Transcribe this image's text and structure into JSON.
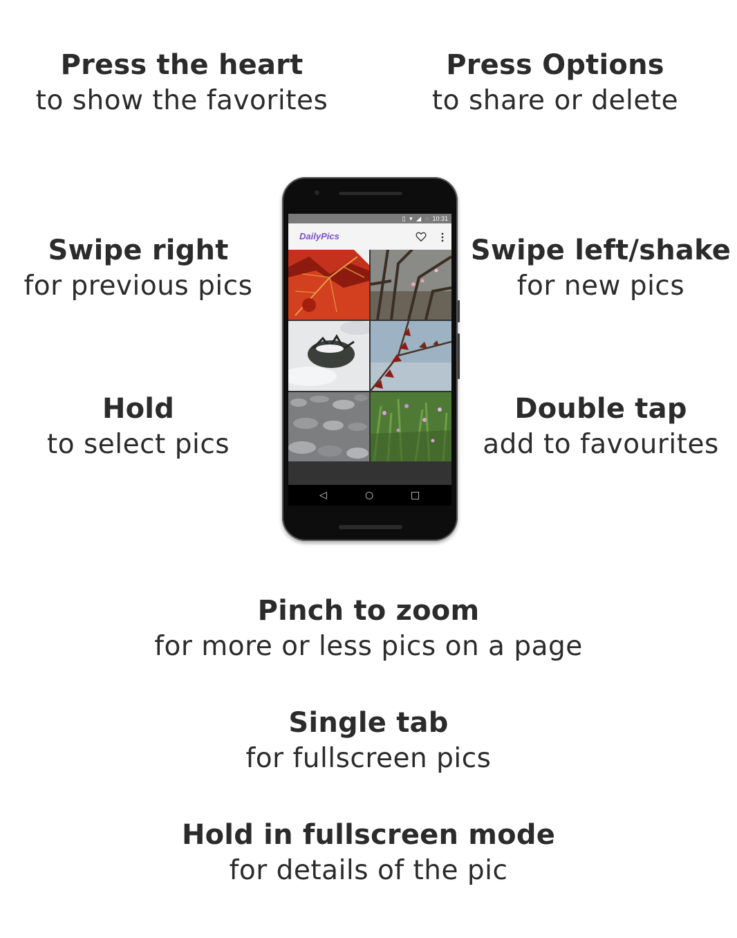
{
  "tips": {
    "heart": {
      "title": "Press the heart",
      "sub": "to show the favorites"
    },
    "options": {
      "title": "Press Options",
      "sub": "to share or delete"
    },
    "swipe_right": {
      "title": "Swipe right",
      "sub": "for previous pics"
    },
    "swipe_left": {
      "title": "Swipe left/shake",
      "sub": "for new pics"
    },
    "hold": {
      "title": "Hold",
      "sub": "to select pics"
    },
    "double_tap": {
      "title": "Double tap",
      "sub": "add to favourites"
    },
    "pinch": {
      "title": "Pinch to zoom",
      "sub": "for more or less pics on a page"
    },
    "single_tab": {
      "title": "Single tab",
      "sub": "for fullscreen pics"
    },
    "hold_fullscreen": {
      "title": "Hold in fullscreen mode",
      "sub": "for details of the pic"
    }
  },
  "phone": {
    "status_time": "10:31",
    "app_title": "DailyPics",
    "heart_icon": "heart-outline-icon",
    "menu_icon": "more-vert-icon",
    "nav": {
      "back": "◁",
      "home": "○",
      "recents": "□"
    },
    "photos": [
      "red-leaf",
      "bare-branches",
      "snowy-bush",
      "red-leaves-sky",
      "gravel-stones",
      "green-plants"
    ]
  },
  "colors": {
    "app_title": "#7a4fc8",
    "text": "#2b2b2b"
  }
}
